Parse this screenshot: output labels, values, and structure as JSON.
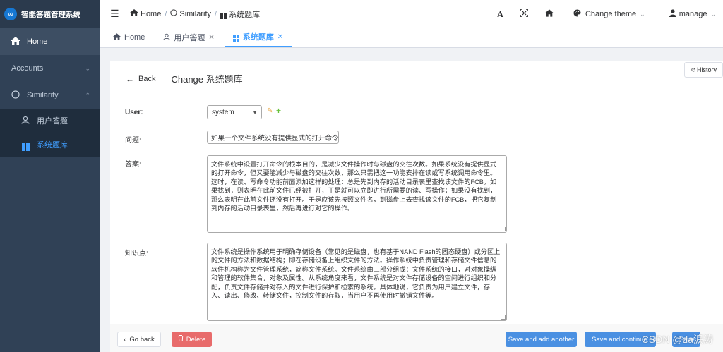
{
  "sidebar": {
    "brand": "智能答题管理系统",
    "logo_glyph": "∞",
    "home": "Home",
    "accounts": "Accounts",
    "similarity": "Similarity",
    "sub_items": [
      "用户答题",
      "系统题库"
    ]
  },
  "navbar": {
    "breadcrumb": [
      "Home",
      "Similarity",
      "系统题库"
    ],
    "font_glyph": "A",
    "theme": "Change theme",
    "user": "manage"
  },
  "tabs": [
    {
      "label": "Home"
    },
    {
      "label": "用户答题"
    },
    {
      "label": "系统题库"
    }
  ],
  "page": {
    "back": "Back",
    "title": "Change 系统题库",
    "history": "History"
  },
  "form": {
    "user_label": "User:",
    "user_value": "system",
    "question_label": "问题:",
    "question_value": "如果一个文件系统没有提供显式的打开命令（",
    "answer_label": "答案:",
    "answer_value": "文件系统中设置打开命令的根本目的，是减少文件操作时与磁盘的交往次数。如果系统没有提供显式的打开命令，但又要能减少与磁盘的交往次数，那么只需把这一功能安排在读或写系统调用命令里。这时，在读、写命令功能前面添加这样的处理：总是先到内存的活动目录表里查找该文件的FCB。如果找到，则表明在此前文件已经被打开，于是就可以立即进行所需要的读、写操作；如果没有找到，那么表明在此前文件还没有打开。于是应该先按照文件名，到磁盘上去查找该文件的FCB，把它复制到内存的活动目录表里，然后再进行对它的操作。",
    "knowledge_label": "知识点:",
    "knowledge_value": "文件系统是操作系统用于明确存储设备（常见的是磁盘，也有基于NAND Flash的固态硬盘）或分区上的文件的方法和数据结构；即在存储设备上组织文件的方法。操作系统中负责管理和存储文件信息的软件机构称为文件管理系统，简称文件系统。文件系统由三部分组成：文件系统的接口，对对象操纵和管理的软件集合，对象及属性。从系统角度来看，文件系统是对文件存储设备的空间进行组织和分配，负责文件存储并对存入的文件进行保护和检索的系统。具体地说，它负责为用户建立文件，存入、读出、修改、转储文件，控制文件的存取，当用户不再使用时撤销文件等。"
  },
  "footer": {
    "go_back": "Go back",
    "delete": "Delete",
    "save_add": "Save and add another",
    "save_continue": "Save and continue editing",
    "save": "Save"
  },
  "watermark": "CSDN @da涙涛"
}
